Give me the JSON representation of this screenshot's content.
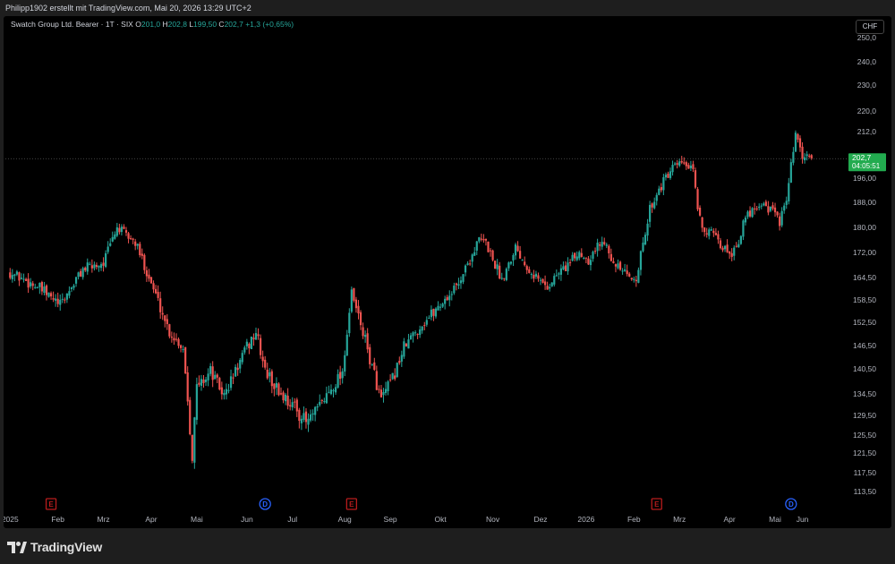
{
  "header": {
    "attribution": "Philipp1902 erstellt mit TradingView.com, Mai 20, 2026 13:29 UTC+2"
  },
  "legend": {
    "symbol": "Swatch Group Ltd. Bearer · 1T · SIX",
    "o_label": "O",
    "o_value": "201,0",
    "h_label": "H",
    "h_value": "202,8",
    "l_label": "L",
    "l_value": "199,50",
    "c_label": "C",
    "c_value": "202,7",
    "change": "+1,3 (+0,65%)"
  },
  "currency_button": "CHF",
  "brand": "TradingView",
  "colors": {
    "up": "#26a69a",
    "down": "#ef5350",
    "price_badge": "#22ab4f",
    "event_earnings": "#b71c1c",
    "event_dividend": "#2962ff"
  },
  "chart_data": {
    "type": "candlestick",
    "last_price_label": "202,7",
    "countdown_label": "04:05:51",
    "last_price": 202.7,
    "y_ticks": [
      "250,0",
      "240,0",
      "230,0",
      "220,0",
      "212,0",
      "196,00",
      "188,00",
      "180,00",
      "172,00",
      "164,50",
      "158,50",
      "152,50",
      "146,50",
      "140,50",
      "134,50",
      "129,50",
      "125,50",
      "121,50",
      "117,50",
      "113,50"
    ],
    "y_tick_values": [
      250,
      240,
      230,
      220,
      212,
      196,
      188,
      180,
      172,
      164.5,
      158.5,
      152.5,
      146.5,
      140.5,
      134.5,
      129.5,
      125.5,
      121.5,
      117.5,
      113.5
    ],
    "x_ticks": [
      "2025",
      "Feb",
      "Mrz",
      "Apr",
      "Mai",
      "Jun",
      "Jul",
      "Aug",
      "Sep",
      "Okt",
      "Nov",
      "Dez",
      "2026",
      "Feb",
      "Mrz",
      "Apr",
      "Mai",
      "Jun"
    ],
    "x_tick_index": [
      0,
      21,
      41,
      62,
      82,
      104,
      124,
      147,
      167,
      189,
      212,
      233,
      253,
      274,
      294,
      316,
      336,
      348
    ],
    "events": [
      {
        "label": "E",
        "kind": "earnings",
        "index": 18
      },
      {
        "label": "D",
        "kind": "dividend",
        "index": 112
      },
      {
        "label": "E",
        "kind": "earnings",
        "index": 150
      },
      {
        "label": "E",
        "kind": "earnings",
        "index": 284
      },
      {
        "label": "D",
        "kind": "dividend",
        "index": 343
      }
    ],
    "path": [
      [
        0,
        166
      ],
      [
        12,
        162
      ],
      [
        22,
        157
      ],
      [
        32,
        167
      ],
      [
        41,
        169
      ],
      [
        47,
        180
      ],
      [
        55,
        175
      ],
      [
        62,
        163
      ],
      [
        70,
        150
      ],
      [
        76,
        146
      ],
      [
        80,
        121
      ],
      [
        82,
        136
      ],
      [
        88,
        140
      ],
      [
        94,
        134
      ],
      [
        104,
        146
      ],
      [
        108,
        150
      ],
      [
        112,
        140
      ],
      [
        118,
        135
      ],
      [
        124,
        132
      ],
      [
        130,
        128
      ],
      [
        134,
        130
      ],
      [
        140,
        135
      ],
      [
        146,
        140
      ],
      [
        150,
        160
      ],
      [
        155,
        150
      ],
      [
        158,
        143
      ],
      [
        163,
        133
      ],
      [
        168,
        138
      ],
      [
        173,
        146
      ],
      [
        178,
        150
      ],
      [
        184,
        154
      ],
      [
        190,
        158
      ],
      [
        196,
        162
      ],
      [
        202,
        170
      ],
      [
        206,
        176
      ],
      [
        209,
        175
      ],
      [
        212,
        170
      ],
      [
        216,
        164
      ],
      [
        222,
        174
      ],
      [
        226,
        169
      ],
      [
        232,
        164
      ],
      [
        236,
        162
      ],
      [
        241,
        166
      ],
      [
        246,
        169
      ],
      [
        250,
        172
      ],
      [
        254,
        170
      ],
      [
        258,
        174
      ],
      [
        262,
        176
      ],
      [
        265,
        168
      ],
      [
        268,
        167
      ],
      [
        272,
        164
      ],
      [
        275,
        165
      ],
      [
        278,
        174
      ],
      [
        281,
        186
      ],
      [
        284,
        191
      ],
      [
        288,
        196
      ],
      [
        292,
        200
      ],
      [
        296,
        201
      ],
      [
        300,
        198
      ],
      [
        302,
        186
      ],
      [
        305,
        179
      ],
      [
        308,
        178
      ],
      [
        312,
        174
      ],
      [
        317,
        172
      ],
      [
        320,
        176
      ],
      [
        323,
        183
      ],
      [
        326,
        186
      ],
      [
        330,
        188
      ],
      [
        335,
        185
      ],
      [
        338,
        182
      ],
      [
        341,
        188
      ],
      [
        343,
        200
      ],
      [
        345,
        211
      ],
      [
        347,
        205
      ],
      [
        349,
        202
      ],
      [
        351,
        204
      ],
      [
        352,
        202.7
      ]
    ],
    "total_bars": 353
  }
}
